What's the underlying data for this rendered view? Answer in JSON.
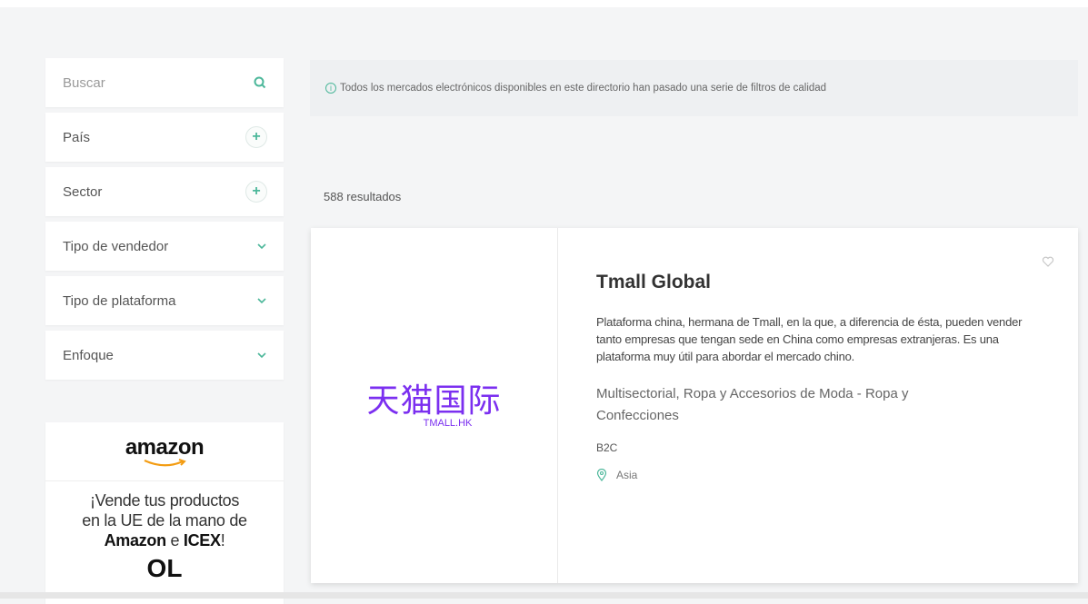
{
  "sidebar": {
    "search_placeholder": "Buscar",
    "filters": [
      {
        "label": "País",
        "control": "plus"
      },
      {
        "label": "Sector",
        "control": "plus"
      },
      {
        "label": "Tipo de vendedor",
        "control": "chevron"
      },
      {
        "label": "Tipo de plataforma",
        "control": "chevron"
      },
      {
        "label": "Enfoque",
        "control": "chevron"
      }
    ]
  },
  "ad": {
    "brand": "amazon",
    "line1": "¡Vende tus productos",
    "line2": "en la UE  de la mano de",
    "line3_a": "Amazon",
    "line3_b": " e ",
    "line3_c": "ICEX",
    "line3_d": "!",
    "logo_text": "OL"
  },
  "notice": {
    "icon": "info-icon",
    "text": "Todos los mercados electrónicos disponibles en este directorio han pasado una serie de filtros de calidad"
  },
  "results": {
    "count_text": "588 resultados"
  },
  "listing": {
    "logo_main": "天猫国际",
    "logo_sub": "TMALL.HK",
    "title": "Tmall Global",
    "description": "Plataforma china, hermana de Tmall, en la que, a diferencia de ésta, pueden vender tanto empresas que tengan sede en China como empresas extranjeras. Es una plataforma muy útil para abordar el mercado chino.",
    "sectors": "Multisectorial, Ropa y Accesorios de Moda - Ropa y Confecciones",
    "type": "B2C",
    "region": "Asia"
  },
  "colors": {
    "accent": "#4cb79a",
    "tmall_purple": "#7b2ff0"
  }
}
